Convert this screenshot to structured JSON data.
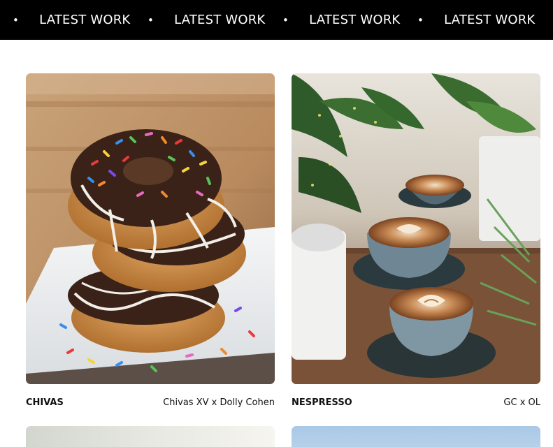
{
  "marquee": {
    "items": [
      {
        "text": "LATEST WORK"
      },
      {
        "text": "LATEST WORK"
      },
      {
        "text": "LATEST WORK"
      },
      {
        "text": "LATEST WORK"
      }
    ]
  },
  "projects": [
    {
      "client": "CHIVAS",
      "title": "Chivas XV x Dolly Cohen",
      "image": "stacked-donuts-photo"
    },
    {
      "client": "NESPRESSO",
      "title": "GC x OL",
      "image": "coffee-cups-plants-photo"
    }
  ],
  "next_row": [
    {
      "image": "neutral-gradient-photo"
    },
    {
      "image": "sky-blue-photo"
    }
  ],
  "colors": {
    "bar": "#000000",
    "bar_text": "#ffffff",
    "background": "#ffffff",
    "text": "#111111"
  }
}
